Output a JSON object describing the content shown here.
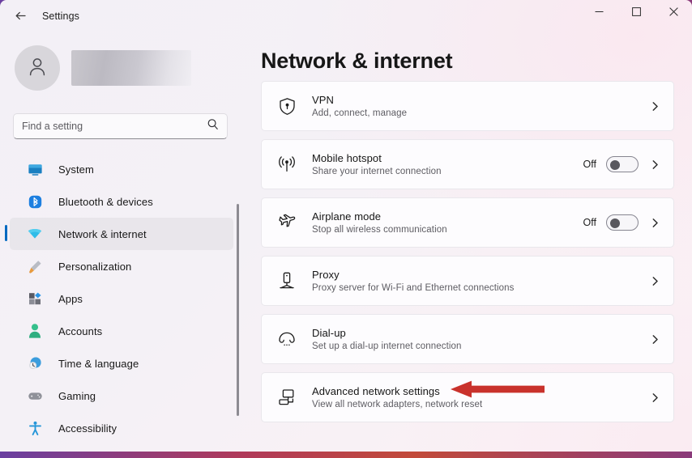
{
  "titlebar": {
    "app_title": "Settings",
    "back_icon": "arrow-left-icon",
    "minimize_label": "—",
    "maximize_label": "□",
    "close_label": "×"
  },
  "sidebar": {
    "profile": {
      "avatar_icon": "person-avatar-icon",
      "username": ""
    },
    "search": {
      "placeholder": "Find a setting",
      "value": "",
      "icon": "search-icon"
    },
    "items": [
      {
        "label": "System",
        "icon": "monitor-icon",
        "selected": false
      },
      {
        "label": "Bluetooth & devices",
        "icon": "bluetooth-icon",
        "selected": false
      },
      {
        "label": "Network & internet",
        "icon": "wifi-icon",
        "selected": true
      },
      {
        "label": "Personalization",
        "icon": "paintbrush-icon",
        "selected": false
      },
      {
        "label": "Apps",
        "icon": "apps-blocks-icon",
        "selected": false
      },
      {
        "label": "Accounts",
        "icon": "person-icon",
        "selected": false
      },
      {
        "label": "Time & language",
        "icon": "globe-clock-icon",
        "selected": false
      },
      {
        "label": "Gaming",
        "icon": "gamepad-icon",
        "selected": false
      },
      {
        "label": "Accessibility",
        "icon": "accessibility-icon",
        "selected": false
      }
    ]
  },
  "main": {
    "page_title": "Network & internet",
    "cards": [
      {
        "title": "VPN",
        "subtitle": "Add, connect, manage",
        "icon": "shield-lock-icon",
        "has_toggle": false,
        "chevron": "chevron-right-icon"
      },
      {
        "title": "Mobile hotspot",
        "subtitle": "Share your internet connection",
        "icon": "hotspot-broadcast-icon",
        "has_toggle": true,
        "toggle_state": "Off",
        "chevron": "chevron-right-icon"
      },
      {
        "title": "Airplane mode",
        "subtitle": "Stop all wireless communication",
        "icon": "airplane-icon",
        "has_toggle": true,
        "toggle_state": "Off",
        "chevron": "chevron-right-icon"
      },
      {
        "title": "Proxy",
        "subtitle": "Proxy server for Wi-Fi and Ethernet connections",
        "icon": "proxy-server-icon",
        "has_toggle": false,
        "chevron": "chevron-right-icon"
      },
      {
        "title": "Dial-up",
        "subtitle": "Set up a dial-up internet connection",
        "icon": "phone-handset-icon",
        "has_toggle": false,
        "chevron": "chevron-right-icon"
      },
      {
        "title": "Advanced network settings",
        "subtitle": "View all network adapters, network reset",
        "icon": "network-workstation-icon",
        "has_toggle": false,
        "chevron": "chevron-right-icon"
      }
    ]
  },
  "annotation": {
    "type": "arrow-left",
    "color": "#c9322c",
    "points_at": "Advanced network settings"
  },
  "colors": {
    "accent_selected": "#0069c0",
    "icon_system": "#0a84c4",
    "icon_bluetooth": "#2a7fe0",
    "icon_network": "#2eb8e6",
    "icon_personalization": "#e09a3a",
    "icon_accounts": "#3cc08a",
    "icon_time": "#2a8fd0",
    "icon_gaming": "#8f8f97",
    "icon_accessibility": "#2596d8",
    "card_bg": "#fdfcfe"
  }
}
